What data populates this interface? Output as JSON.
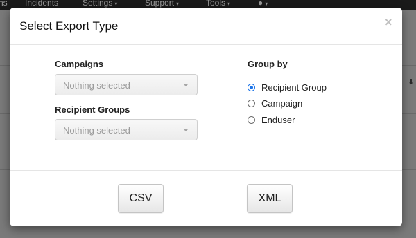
{
  "navbar": {
    "items": [
      {
        "label": "ns",
        "caret": false
      },
      {
        "label": "Incidents",
        "caret": false
      },
      {
        "label": "Settings",
        "caret": true
      },
      {
        "label": "Support",
        "caret": true
      },
      {
        "label": "Tools",
        "caret": true
      },
      {
        "label": "",
        "caret": true
      }
    ]
  },
  "modal": {
    "title": "Select Export Type",
    "close_symbol": "×",
    "campaigns": {
      "label": "Campaigns",
      "value": "Nothing selected"
    },
    "recipient_groups": {
      "label": "Recipient Groups",
      "value": "Nothing selected"
    },
    "group_by": {
      "label": "Group by",
      "options": [
        {
          "label": "Recipient Group",
          "checked": true
        },
        {
          "label": "Campaign",
          "checked": false
        },
        {
          "label": "Enduser",
          "checked": false
        }
      ]
    },
    "buttons": {
      "csv": "CSV",
      "xml": "XML"
    }
  },
  "colors": {
    "accent": "#1a73e8",
    "overlay": "#6f6f6f"
  }
}
